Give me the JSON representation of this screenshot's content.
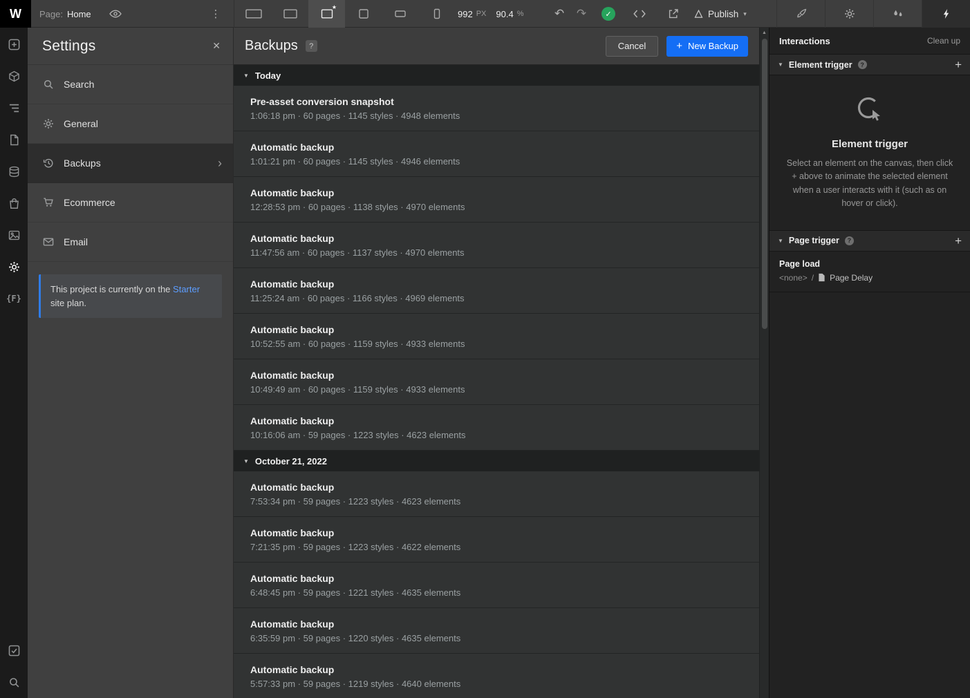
{
  "glyphs": {
    "logo": "W",
    "kebab": "⋮",
    "undo": "↶",
    "redo": "↷",
    "check": "✓",
    "chevron_down": "▾",
    "chevron_right": "›",
    "triangle_down": "▼",
    "close": "✕",
    "star": "★",
    "plus": "+",
    "help": "?",
    "scroll_up_arrow": "▲",
    "fonts": "{F}"
  },
  "colors": {
    "accent_blue": "#146ef5",
    "link_blue": "#5d9dff",
    "success_green": "#27a35c"
  },
  "topbar": {
    "page_label": "Page:",
    "page_name": "Home",
    "canvas_width": "992",
    "canvas_width_unit": "PX",
    "zoom": "90.4",
    "zoom_unit": "%",
    "publish_label": "Publish"
  },
  "settings_panel": {
    "title": "Settings",
    "items": [
      {
        "label": "Search",
        "icon": "search-icon"
      },
      {
        "label": "General",
        "icon": "gear-icon"
      },
      {
        "label": "Backups",
        "icon": "history-icon",
        "selected": true
      },
      {
        "label": "Ecommerce",
        "icon": "cart-icon"
      },
      {
        "label": "Email",
        "icon": "email-icon"
      }
    ],
    "plan_notice": {
      "text_before": "This project is currently on the ",
      "link_text": "Starter",
      "text_after": " site plan."
    }
  },
  "backups_panel": {
    "title": "Backups",
    "help_badge": "?",
    "cancel_label": "Cancel",
    "new_backup_label": "New Backup",
    "sections": [
      {
        "header": "Today",
        "items": [
          {
            "title": "Pre-asset conversion snapshot",
            "meta": "1:06:18 pm · 60 pages · 1145 styles · 4948 elements"
          },
          {
            "title": "Automatic backup",
            "meta": "1:01:21 pm · 60 pages · 1145 styles · 4946 elements"
          },
          {
            "title": "Automatic backup",
            "meta": "12:28:53 pm · 60 pages · 1138 styles · 4970 elements"
          },
          {
            "title": "Automatic backup",
            "meta": "11:47:56 am · 60 pages · 1137 styles · 4970 elements"
          },
          {
            "title": "Automatic backup",
            "meta": "11:25:24 am · 60 pages · 1166 styles · 4969 elements"
          },
          {
            "title": "Automatic backup",
            "meta": "10:52:55 am · 60 pages · 1159 styles · 4933 elements"
          },
          {
            "title": "Automatic backup",
            "meta": "10:49:49 am · 60 pages · 1159 styles · 4933 elements"
          },
          {
            "title": "Automatic backup",
            "meta": "10:16:06 am · 59 pages · 1223 styles · 4623 elements"
          }
        ]
      },
      {
        "header": "October 21, 2022",
        "items": [
          {
            "title": "Automatic backup",
            "meta": "7:53:34 pm · 59 pages · 1223 styles · 4623 elements"
          },
          {
            "title": "Automatic backup",
            "meta": "7:21:35 pm · 59 pages · 1223 styles · 4622 elements"
          },
          {
            "title": "Automatic backup",
            "meta": "6:48:45 pm · 59 pages · 1221 styles · 4635 elements"
          },
          {
            "title": "Automatic backup",
            "meta": "6:35:59 pm · 59 pages · 1220 styles · 4635 elements"
          },
          {
            "title": "Automatic backup",
            "meta": "5:57:33 pm · 59 pages · 1219 styles · 4640 elements"
          }
        ]
      }
    ]
  },
  "interactions_panel": {
    "title": "Interactions",
    "clean_up_label": "Clean up",
    "element_trigger": {
      "header_label": "Element trigger",
      "icon_title": "Element trigger",
      "description": "Select an element on the canvas, then click + above to animate the selected element when a user interacts with it (such as on hover or click)."
    },
    "page_trigger": {
      "header_label": "Page trigger",
      "item": {
        "title": "Page load",
        "value": "<none>",
        "separator": "/",
        "action": "Page Delay"
      }
    }
  }
}
